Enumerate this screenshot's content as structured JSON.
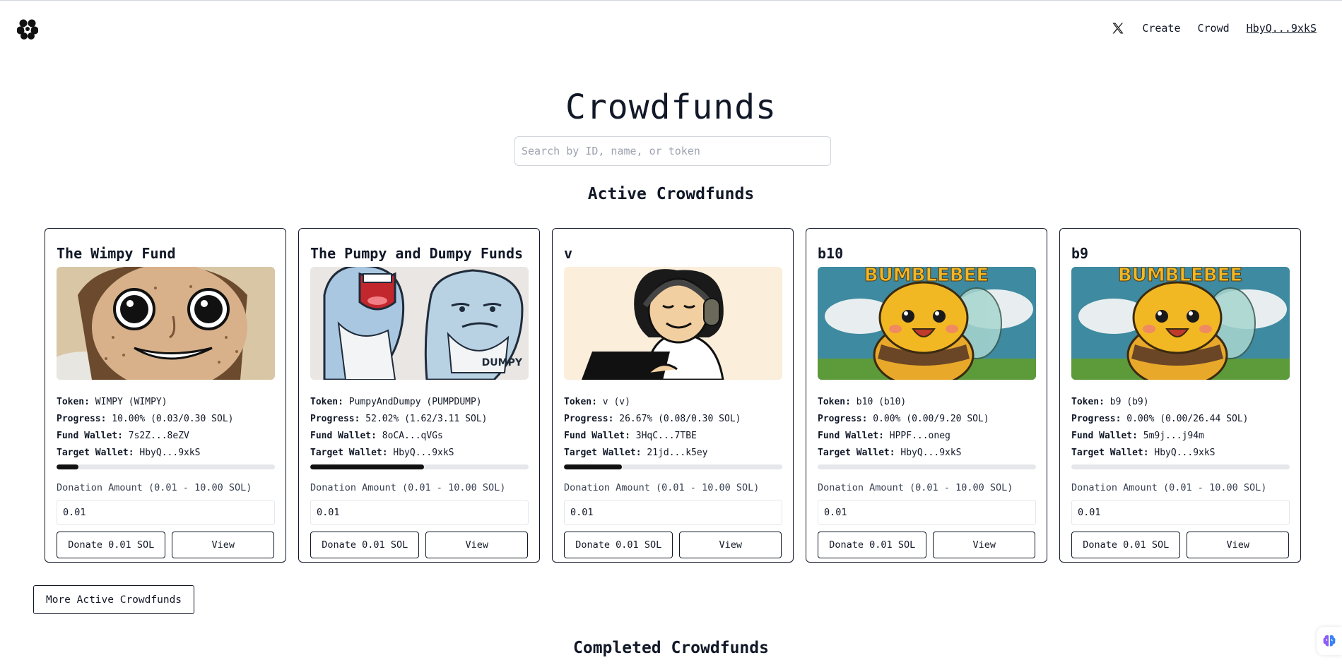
{
  "header": {
    "logo": "flower-logo-icon",
    "nav": {
      "x_icon": "x-twitter-icon",
      "create_label": "Create",
      "crowd_label": "Crowd",
      "wallet_label": "HbyQ...9xkS"
    }
  },
  "page_title": "Crowdfunds",
  "search": {
    "placeholder": "Search by ID, name, or token"
  },
  "active_section_title": "Active Crowdfunds",
  "cards": [
    {
      "title": "The Wimpy Fund",
      "image": "wimpy-cartoon-face",
      "token_label": "Token:",
      "token": "WIMPY (WIMPY)",
      "progress_label": "Progress:",
      "progress": "10.00% (0.03/0.30 SOL)",
      "progress_value": 0.1,
      "fund_wallet_label": "Fund Wallet:",
      "fund_wallet": "7s2Z...8eZV",
      "target_wallet_label": "Target Wallet:",
      "target_wallet": "HbyQ...9xkS",
      "donation_label": "Donation Amount (0.01 - 10.00 SOL)",
      "amount": "0.01",
      "donate_label": "Donate 0.01 SOL",
      "view_label": "View"
    },
    {
      "title": "The Pumpy and Dumpy Funds",
      "image": "two-whales-cartoon",
      "image_text": "DUMPY",
      "token_label": "Token:",
      "token": "PumpyAndDumpy (PUMPDUMP)",
      "progress_label": "Progress:",
      "progress": "52.02% (1.62/3.11 SOL)",
      "progress_value": 0.5202,
      "fund_wallet_label": "Fund Wallet:",
      "fund_wallet": "8oCA...qVGs",
      "target_wallet_label": "Target Wallet:",
      "target_wallet": "HbyQ...9xkS",
      "donation_label": "Donation Amount (0.01 - 10.00 SOL)",
      "amount": "0.01",
      "donate_label": "Donate 0.01 SOL",
      "view_label": "View"
    },
    {
      "title": "v",
      "image": "man-with-headphones-laptop",
      "token_label": "Token:",
      "token": "v (v)",
      "progress_label": "Progress:",
      "progress": "26.67% (0.08/0.30 SOL)",
      "progress_value": 0.2667,
      "fund_wallet_label": "Fund Wallet:",
      "fund_wallet": "3HqC...7TBE",
      "target_wallet_label": "Target Wallet:",
      "target_wallet": "21jd...k5ey",
      "donation_label": "Donation Amount (0.01 - 10.00 SOL)",
      "amount": "0.01",
      "donate_label": "Donate 0.01 SOL",
      "view_label": "View"
    },
    {
      "title": "b10",
      "image": "bumblebee-cartoon",
      "image_text": "BUMBLEBEE",
      "token_label": "Token:",
      "token": "b10 (b10)",
      "progress_label": "Progress:",
      "progress": "0.00% (0.00/9.20 SOL)",
      "progress_value": 0,
      "fund_wallet_label": "Fund Wallet:",
      "fund_wallet": "HPPF...oneg",
      "target_wallet_label": "Target Wallet:",
      "target_wallet": "HbyQ...9xkS",
      "donation_label": "Donation Amount (0.01 - 10.00 SOL)",
      "amount": "0.01",
      "donate_label": "Donate 0.01 SOL",
      "view_label": "View"
    },
    {
      "title": "b9",
      "image": "bumblebee-cartoon",
      "image_text": "BUMBLEBEE",
      "token_label": "Token:",
      "token": "b9 (b9)",
      "progress_label": "Progress:",
      "progress": "0.00% (0.00/26.44 SOL)",
      "progress_value": 0,
      "fund_wallet_label": "Fund Wallet:",
      "fund_wallet": "5m9j...j94m",
      "target_wallet_label": "Target Wallet:",
      "target_wallet": "HbyQ...9xkS",
      "donation_label": "Donation Amount (0.01 - 10.00 SOL)",
      "amount": "0.01",
      "donate_label": "Donate 0.01 SOL",
      "view_label": "View"
    }
  ],
  "more_button_label": "More Active Crowdfunds",
  "completed_section_title": "Completed Crowdfunds",
  "floating_widget": "brain-icon",
  "colors": {
    "text": "#111827",
    "border": "#111827",
    "bar_fill": "#111111",
    "bar_track": "#e5e7eb"
  }
}
